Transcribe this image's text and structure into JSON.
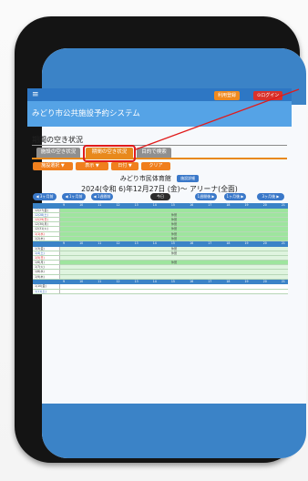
{
  "header": {
    "menu_icon": "≡",
    "register_label": "利用登録",
    "login_label": "⊙ログイン",
    "system_title": "みどり市公共施設予約システム"
  },
  "page": {
    "heading": "期間の空き状況",
    "tabs": [
      {
        "label": "施設の空き状況"
      },
      {
        "label": "期間の空き状況"
      },
      {
        "label": "目的で検索"
      }
    ],
    "actions": [
      {
        "label": "施設選択 ▼"
      },
      {
        "label": "表示 ▼"
      },
      {
        "label": "日付 ▼"
      },
      {
        "label": "クリア"
      }
    ]
  },
  "facility": {
    "name": "みどり市民体育館",
    "badge": "施設詳細",
    "date_range": "2024(令和 6)年12月27日 (金)〜 アリーナ(全面)"
  },
  "navigation": {
    "prev3": "◀ 3ヶ月前",
    "prev1": "◀ 1ヶ月前",
    "prev_week": "◀ 1週間前",
    "today": "今日",
    "next_week": "1週間後 ▶",
    "next1": "1ヶ月後 ▶",
    "next3": "3ヶ月後 ▶"
  },
  "calendar": {
    "hours": [
      "9",
      "10",
      "11",
      "12",
      "13",
      "14",
      "15",
      "16",
      "17",
      "18",
      "19",
      "20",
      "21"
    ],
    "days": [
      {
        "label": "12/27(金)",
        "status": "avail",
        "note": "",
        "color": "normal"
      },
      {
        "label": "12/28(土)",
        "status": "avail",
        "note": "休館",
        "color": "blue"
      },
      {
        "label": "12/29(日)",
        "status": "avail",
        "note": "休館",
        "color": "red"
      },
      {
        "label": "12/30(月)",
        "status": "avail",
        "note": "休館",
        "color": "normal"
      },
      {
        "label": "12/31(火)",
        "status": "avail",
        "note": "休館",
        "color": "normal"
      },
      {
        "label": "1/1(水)",
        "status": "avail",
        "note": "休館",
        "color": "red"
      },
      {
        "label": "1/2(木)",
        "status": "avail",
        "note": "休館",
        "color": "normal"
      },
      {
        "label": "1/3(金)",
        "status": "closed",
        "note": "休館",
        "color": "normal"
      },
      {
        "label": "1/4(土)",
        "status": "closed",
        "note": "休館",
        "color": "blue"
      },
      {
        "label": "1/5(日)",
        "status": "closed",
        "note": "",
        "color": "red"
      },
      {
        "label": "1/6(月)",
        "status": "avail",
        "note": "休館",
        "color": "normal"
      },
      {
        "label": "1/7(火)",
        "status": "closed",
        "note": "",
        "color": "normal"
      },
      {
        "label": "1/8(水)",
        "status": "closed",
        "note": "",
        "color": "normal"
      },
      {
        "label": "1/9(木)",
        "status": "closed",
        "note": "",
        "color": "normal"
      },
      {
        "label": "1/10(金)",
        "status": "white",
        "note": "",
        "color": "normal"
      },
      {
        "label": "1/11(土)",
        "status": "white",
        "note": "",
        "color": "blue"
      }
    ]
  }
}
